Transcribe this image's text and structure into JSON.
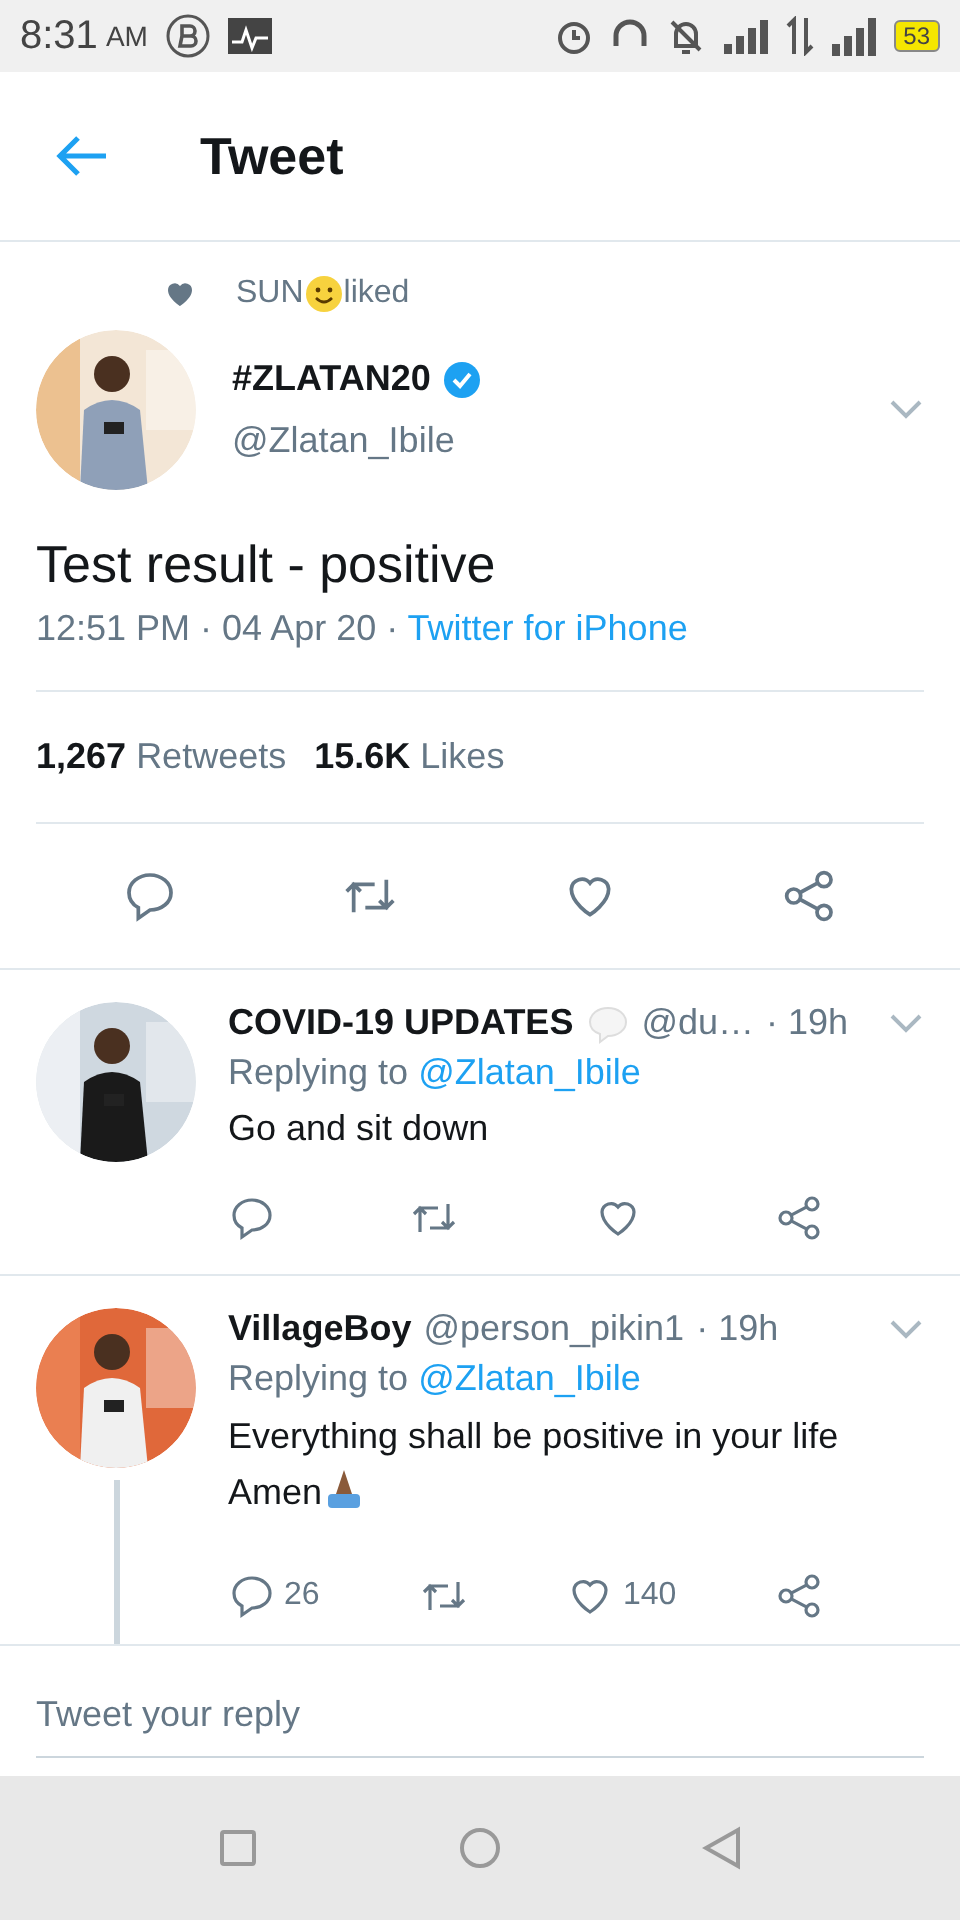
{
  "status_bar": {
    "time": "8:31",
    "ampm": "AM",
    "battery": "53"
  },
  "header": {
    "title": "Tweet"
  },
  "social_context": {
    "name": "SUN",
    "action": "liked"
  },
  "tweet": {
    "display_name": "#ZLATAN20",
    "verified": true,
    "handle": "@Zlatan_Ibile",
    "text": "Test result - positive",
    "time": "12:51 PM · 04 Apr 20 · ",
    "source": "Twitter for iPhone",
    "stats": [
      {
        "count": "1,267",
        "label": "Retweets"
      },
      {
        "count": "15.6K",
        "label": "Likes"
      }
    ]
  },
  "replies": [
    {
      "name": "COVID-19 UPDATES",
      "handle": "@du…",
      "time": "· 19h",
      "speech_mark": true,
      "replying_label": "Replying to",
      "replying_to": "@Zlatan_Ibile",
      "text": "Go and sit down",
      "prayer": false,
      "thread": false
    },
    {
      "name": "VillageBoy",
      "handle": "@person_pikin1",
      "time": "· 19h",
      "speech_mark": false,
      "replying_label": "Replying to",
      "replying_to": "@Zlatan_Ibile",
      "text": "Everything shall be positive in your life Amen",
      "prayer": true,
      "thread": true,
      "reply_count": "26",
      "like_count": "140"
    }
  ],
  "reply_field": {
    "placeholder": "Tweet your reply"
  }
}
